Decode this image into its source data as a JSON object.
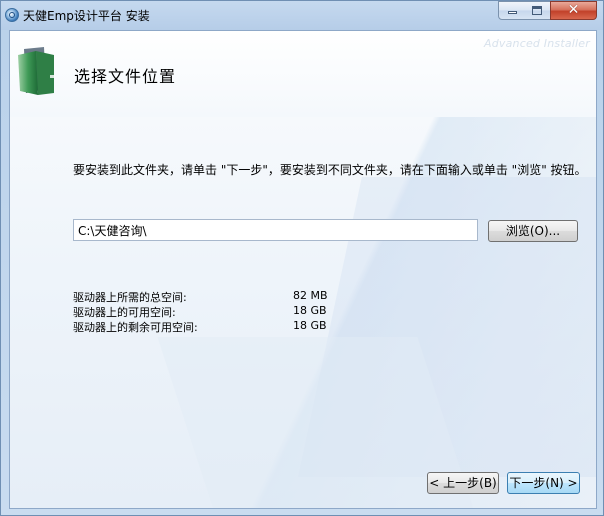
{
  "window": {
    "title": "天健Emp设计平台 安装",
    "controls": {
      "minimize": "minimize",
      "maximize": "maximize",
      "close": "close"
    }
  },
  "header": {
    "brand": "Advanced Installer",
    "title": "选择文件位置",
    "icon": "folder-icon"
  },
  "instructions": "要安装到此文件夹，请单击 \"下一步\"，要安装到不同文件夹，请在下面输入或单击 \"浏览\" 按钮。",
  "path": {
    "value": "C:\\天健咨询\\"
  },
  "buttons": {
    "browse": "浏览(O)...",
    "back": "< 上一步(B)",
    "next": "下一步(N) >"
  },
  "space": [
    {
      "label": "驱动器上所需的总空间:",
      "value": "82 MB"
    },
    {
      "label": "驱动器上的可用空间:",
      "value": "18 GB"
    },
    {
      "label": "驱动器上的剩余可用空间:",
      "value": "18 GB"
    }
  ],
  "colors": {
    "titlebar": "#b6cde8",
    "close_button": "#c2412a",
    "next_button_border": "#3c7fb1"
  }
}
